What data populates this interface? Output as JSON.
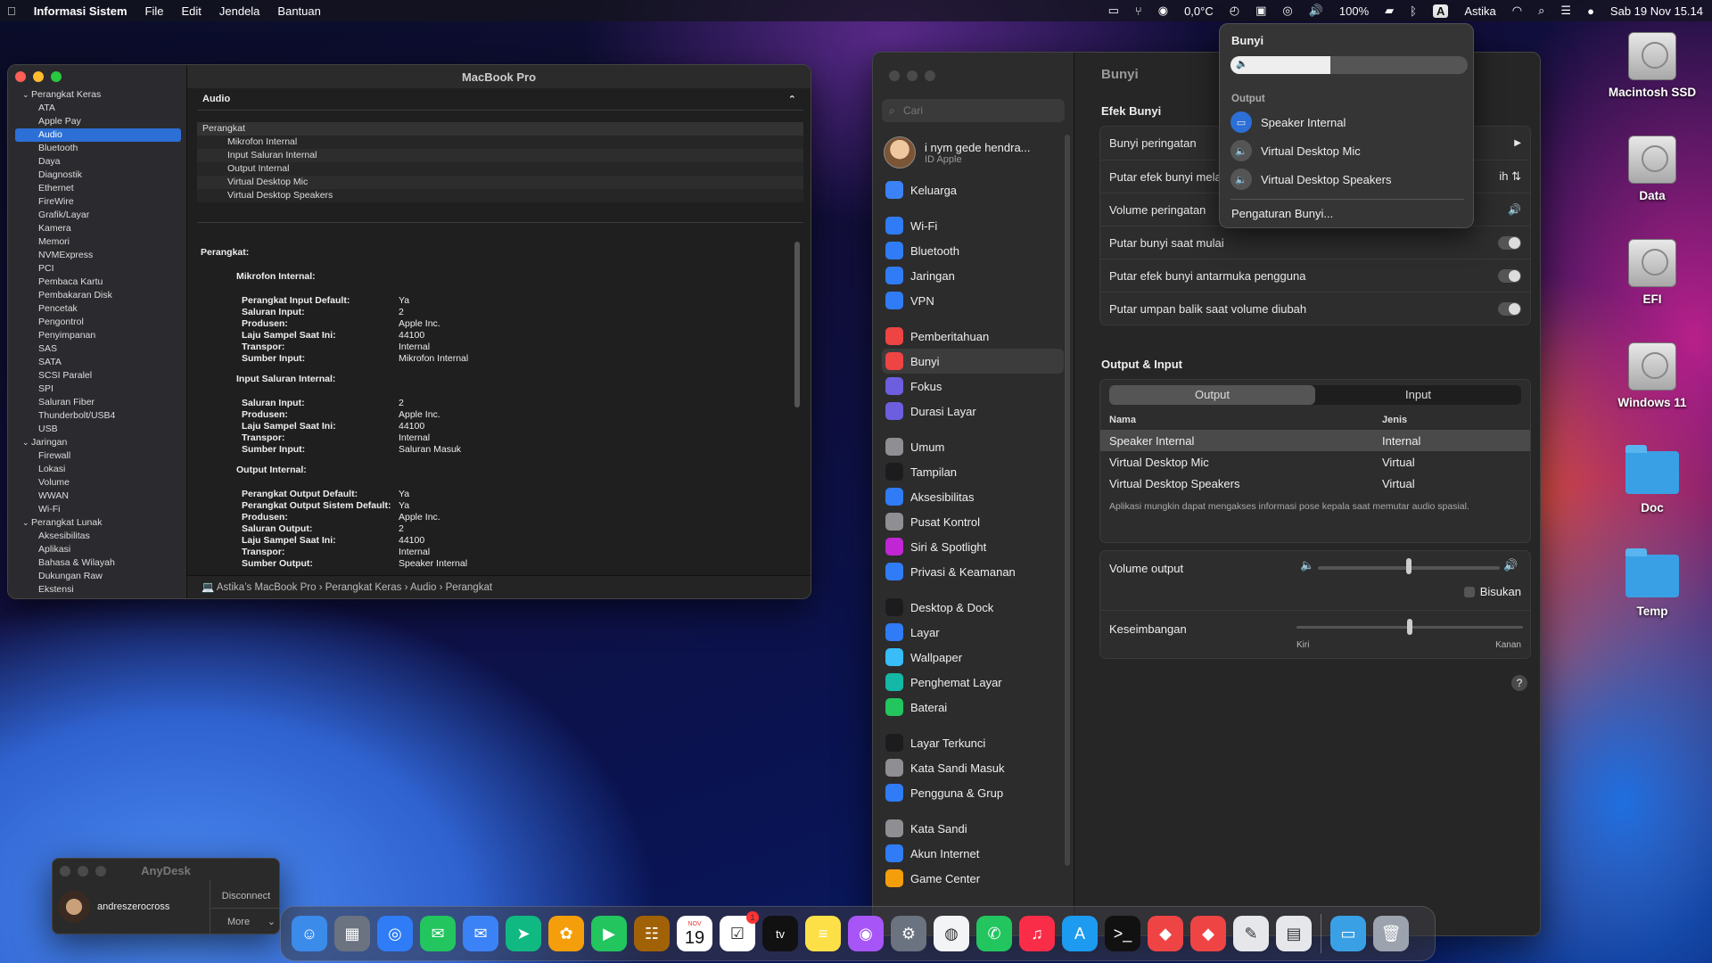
{
  "menubar": {
    "app": "Informasi Sistem",
    "items": [
      "File",
      "Edit",
      "Jendela",
      "Bantuan"
    ],
    "status": {
      "temp": "0,0°C",
      "battery": "100%",
      "input": "A",
      "user": "Astika",
      "datetime": "Sab 19 Nov  15.14"
    }
  },
  "sysinfo": {
    "title": "MacBook Pro",
    "tree": [
      {
        "label": "Perangkat Keras",
        "top": true
      },
      {
        "label": "ATA"
      },
      {
        "label": "Apple Pay"
      },
      {
        "label": "Audio",
        "sel": true
      },
      {
        "label": "Bluetooth"
      },
      {
        "label": "Daya"
      },
      {
        "label": "Diagnostik"
      },
      {
        "label": "Ethernet"
      },
      {
        "label": "FireWire"
      },
      {
        "label": "Grafik/Layar"
      },
      {
        "label": "Kamera"
      },
      {
        "label": "Memori"
      },
      {
        "label": "NVMExpress"
      },
      {
        "label": "PCI"
      },
      {
        "label": "Pembaca Kartu"
      },
      {
        "label": "Pembakaran Disk"
      },
      {
        "label": "Pencetak"
      },
      {
        "label": "Pengontrol"
      },
      {
        "label": "Penyimpanan"
      },
      {
        "label": "SAS"
      },
      {
        "label": "SATA"
      },
      {
        "label": "SCSI Paralel"
      },
      {
        "label": "SPI"
      },
      {
        "label": "Saluran Fiber"
      },
      {
        "label": "Thunderbolt/USB4"
      },
      {
        "label": "USB"
      },
      {
        "label": "Jaringan",
        "top": true
      },
      {
        "label": "Firewall"
      },
      {
        "label": "Lokasi"
      },
      {
        "label": "Volume"
      },
      {
        "label": "WWAN"
      },
      {
        "label": "Wi-Fi"
      },
      {
        "label": "Perangkat Lunak",
        "top": true
      },
      {
        "label": "Aksesibilitas"
      },
      {
        "label": "Aplikasi"
      },
      {
        "label": "Bahasa & Wilayah"
      },
      {
        "label": "Dukungan Raw"
      },
      {
        "label": "Ekstensi"
      }
    ],
    "section": "Audio",
    "devices_header": "Perangkat",
    "devices": [
      "Mikrofon Internal",
      "Input Saluran Internal",
      "Output Internal",
      "Virtual Desktop Mic",
      "Virtual Desktop Speakers"
    ],
    "detail_title": "Perangkat:",
    "groups": [
      {
        "name": "Mikrofon Internal:",
        "rows": [
          [
            "Perangkat Input Default:",
            "Ya"
          ],
          [
            "Saluran Input:",
            "2"
          ],
          [
            "Produsen:",
            "Apple Inc."
          ],
          [
            "Laju Sampel Saat Ini:",
            "44100"
          ],
          [
            "Transpor:",
            "Internal"
          ],
          [
            "Sumber Input:",
            "Mikrofon Internal"
          ]
        ]
      },
      {
        "name": "Input Saluran Internal:",
        "rows": [
          [
            "Saluran Input:",
            "2"
          ],
          [
            "Produsen:",
            "Apple Inc."
          ],
          [
            "Laju Sampel Saat Ini:",
            "44100"
          ],
          [
            "Transpor:",
            "Internal"
          ],
          [
            "Sumber Input:",
            "Saluran Masuk"
          ]
        ]
      },
      {
        "name": "Output Internal:",
        "rows": [
          [
            "Perangkat Output Default:",
            "Ya"
          ],
          [
            "Perangkat Output Sistem Default:",
            "Ya"
          ],
          [
            "Produsen:",
            "Apple Inc."
          ],
          [
            "Saluran Output:",
            "2"
          ],
          [
            "Laju Sampel Saat Ini:",
            "44100"
          ],
          [
            "Transpor:",
            "Internal"
          ],
          [
            "Sumber Output:",
            "Speaker Internal"
          ]
        ]
      }
    ],
    "breadcrumb": "Astika’s MacBook Pro  ›  Perangkat Keras  ›  Audio  ›  Perangkat"
  },
  "settings": {
    "title": "Bunyi",
    "search_placeholder": "Cari",
    "apple_id_name": "i nym gede hendra...",
    "apple_id_sub": "ID Apple",
    "nav": [
      {
        "label": "Keluarga",
        "color": "#3b82f6"
      },
      {
        "gap": true
      },
      {
        "label": "Wi-Fi",
        "color": "#2f7cf6"
      },
      {
        "label": "Bluetooth",
        "color": "#2f7cf6"
      },
      {
        "label": "Jaringan",
        "color": "#2f7cf6"
      },
      {
        "label": "VPN",
        "color": "#2f7cf6"
      },
      {
        "gap": true
      },
      {
        "label": "Pemberitahuan",
        "color": "#ef4444"
      },
      {
        "label": "Bunyi",
        "color": "#ef4444",
        "sel": true
      },
      {
        "label": "Fokus",
        "color": "#6d5ee0"
      },
      {
        "label": "Durasi Layar",
        "color": "#6d5ee0"
      },
      {
        "gap": true
      },
      {
        "label": "Umum",
        "color": "#8e8e93"
      },
      {
        "label": "Tampilan",
        "color": "#1c1c1e"
      },
      {
        "label": "Aksesibilitas",
        "color": "#2f7cf6"
      },
      {
        "label": "Pusat Kontrol",
        "color": "#8e8e93"
      },
      {
        "label": "Siri & Spotlight",
        "color": "#c026d3"
      },
      {
        "label": "Privasi & Keamanan",
        "color": "#2f7cf6"
      },
      {
        "gap": true
      },
      {
        "label": "Desktop & Dock",
        "color": "#1c1c1e"
      },
      {
        "label": "Layar",
        "color": "#2f7cf6"
      },
      {
        "label": "Wallpaper",
        "color": "#38bdf8"
      },
      {
        "label": "Penghemat Layar",
        "color": "#14b8a6"
      },
      {
        "label": "Baterai",
        "color": "#22c55e"
      },
      {
        "gap": true
      },
      {
        "label": "Layar Terkunci",
        "color": "#1c1c1e"
      },
      {
        "label": "Kata Sandi Masuk",
        "color": "#8e8e93"
      },
      {
        "label": "Pengguna & Grup",
        "color": "#2f7cf6"
      },
      {
        "gap": true
      },
      {
        "label": "Kata Sandi",
        "color": "#8e8e93"
      },
      {
        "label": "Akun Internet",
        "color": "#2f7cf6"
      },
      {
        "label": "Game Center",
        "color": "#f59e0b"
      }
    ],
    "efek_title": "Efek Bunyi",
    "efek": [
      {
        "label": "Bunyi peringatan"
      },
      {
        "label": "Putar efek bunyi melalui",
        "value": "ih"
      },
      {
        "label": "Volume peringatan"
      },
      {
        "label": "Putar bunyi saat mulai",
        "toggle": true
      },
      {
        "label": "Putar efek bunyi antarmuka pengguna",
        "toggle": true
      },
      {
        "label": "Putar umpan balik saat volume diubah",
        "toggle": true
      }
    ],
    "oi_title": "Output & Input",
    "tabs": [
      "Output",
      "Input"
    ],
    "col_name": "Nama",
    "col_type": "Jenis",
    "rows": [
      {
        "name": "Speaker Internal",
        "type": "Internal",
        "sel": true
      },
      {
        "name": "Virtual Desktop Mic",
        "type": "Virtual"
      },
      {
        "name": "Virtual Desktop Speakers",
        "type": "Virtual"
      }
    ],
    "note": "Aplikasi mungkin dapat mengakses informasi pose kepala saat memutar audio spasial.",
    "volume_label": "Volume output",
    "volume_level": 0.5,
    "mute_label": "Bisukan",
    "balance_label": "Keseimbangan",
    "balance_left": "Kiri",
    "balance_right": "Kanan",
    "balance_level": 0.5,
    "help": "?"
  },
  "popup": {
    "title": "Bunyi",
    "volume_level": 0.42,
    "output_label": "Output",
    "items": [
      "Speaker Internal",
      "Virtual Desktop Mic",
      "Virtual Desktop Speakers"
    ],
    "settings_link": "Pengaturan Bunyi..."
  },
  "desktop": [
    {
      "label": "Macintosh SSD",
      "kind": "drive"
    },
    {
      "label": "Data",
      "kind": "drive"
    },
    {
      "label": "EFI",
      "kind": "drive"
    },
    {
      "label": "Windows 11",
      "kind": "drive"
    },
    {
      "label": "Doc",
      "kind": "folder"
    },
    {
      "label": "Temp",
      "kind": "folder"
    }
  ],
  "anydesk": {
    "title": "AnyDesk",
    "user": "andreszerocross",
    "disconnect": "Disconnect",
    "more": "More"
  },
  "dock": {
    "calendar_month": "NOV",
    "calendar_day": "19",
    "reminders_badge": "1",
    "tv": "tv",
    "apps": [
      {
        "name": "finder",
        "color": "#3b8beb"
      },
      {
        "name": "launchpad",
        "color": "#6b7280"
      },
      {
        "name": "safari",
        "color": "#2f7cf6"
      },
      {
        "name": "messages",
        "color": "#22c55e"
      },
      {
        "name": "mail",
        "color": "#3b82f6"
      },
      {
        "name": "maps",
        "color": "#10b981"
      },
      {
        "name": "photos",
        "color": "#f59e0b"
      },
      {
        "name": "facetime",
        "color": "#22c55e"
      },
      {
        "name": "contacts",
        "color": "#a16207"
      },
      {
        "name": "calendar",
        "color": "#ffffff"
      },
      {
        "name": "reminders",
        "color": "#ffffff"
      },
      {
        "name": "appletv",
        "color": "#111111"
      },
      {
        "name": "notes",
        "color": "#fde047"
      },
      {
        "name": "podcasts",
        "color": "#a855f7"
      },
      {
        "name": "system-settings",
        "color": "#6b7280"
      },
      {
        "name": "chrome",
        "color": "#f3f4f6"
      },
      {
        "name": "whatsapp",
        "color": "#22c55e"
      },
      {
        "name": "music",
        "color": "#fa2d48"
      },
      {
        "name": "appstore",
        "color": "#1d9bf0"
      },
      {
        "name": "terminal",
        "color": "#111111"
      },
      {
        "name": "anydesk",
        "color": "#ef4444"
      },
      {
        "name": "anydesk-2",
        "color": "#ef4444"
      },
      {
        "name": "textedit",
        "color": "#e5e7eb"
      },
      {
        "name": "preview",
        "color": "#e5e7eb"
      },
      {
        "name": "downloads",
        "color": "#3aa0e6"
      },
      {
        "name": "trash",
        "color": "#9ca3af"
      }
    ]
  }
}
